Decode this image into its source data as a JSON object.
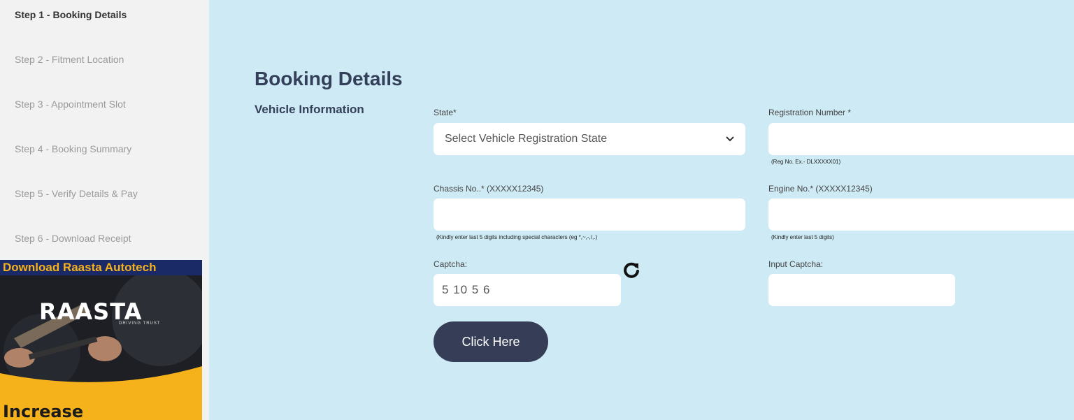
{
  "steps": [
    {
      "label": "Step 1 - Booking Details",
      "active": true
    },
    {
      "label": "Step 2 - Fitment Location"
    },
    {
      "label": "Step 3 - Appointment Slot"
    },
    {
      "label": "Step 4 - Booking Summary"
    },
    {
      "label": "Step 5 - Verify Details & Pay"
    },
    {
      "label": "Step 6 - Download Receipt"
    }
  ],
  "promo": {
    "headline": "Download Raasta Autotech",
    "logo_text": "RAASTA",
    "tagline": "DRIVING TRUST",
    "bottom_text": "Increase"
  },
  "page": {
    "title": "Booking Details",
    "section": "Vehicle Information"
  },
  "form": {
    "state": {
      "label": "State*",
      "selected": "Select Vehicle Registration State"
    },
    "registration": {
      "label": "Registration Number *",
      "value": "",
      "hint": "(Reg No. Ex.- DLXXXXX01)"
    },
    "chassis": {
      "label": "Chassis No..* (XXXXX12345)",
      "value": "",
      "hint": "(Kindly enter last 5 digits including special characters (eg *,~,-,/,.)"
    },
    "engine": {
      "label": "Engine No.* (XXXXX12345)",
      "value": "",
      "hint": "(Kindly enter last 5 digits)"
    },
    "captcha": {
      "label": "Captcha:",
      "value": "5 10  5 6"
    },
    "input_captcha": {
      "label": "Input Captcha:",
      "value": ""
    },
    "submit": "Click Here"
  },
  "colors": {
    "background": "#cdeaf5",
    "sidebar": "#f2f2f2",
    "heading": "#34405a",
    "button": "#363e57",
    "promo_accent": "#f5b21b"
  }
}
